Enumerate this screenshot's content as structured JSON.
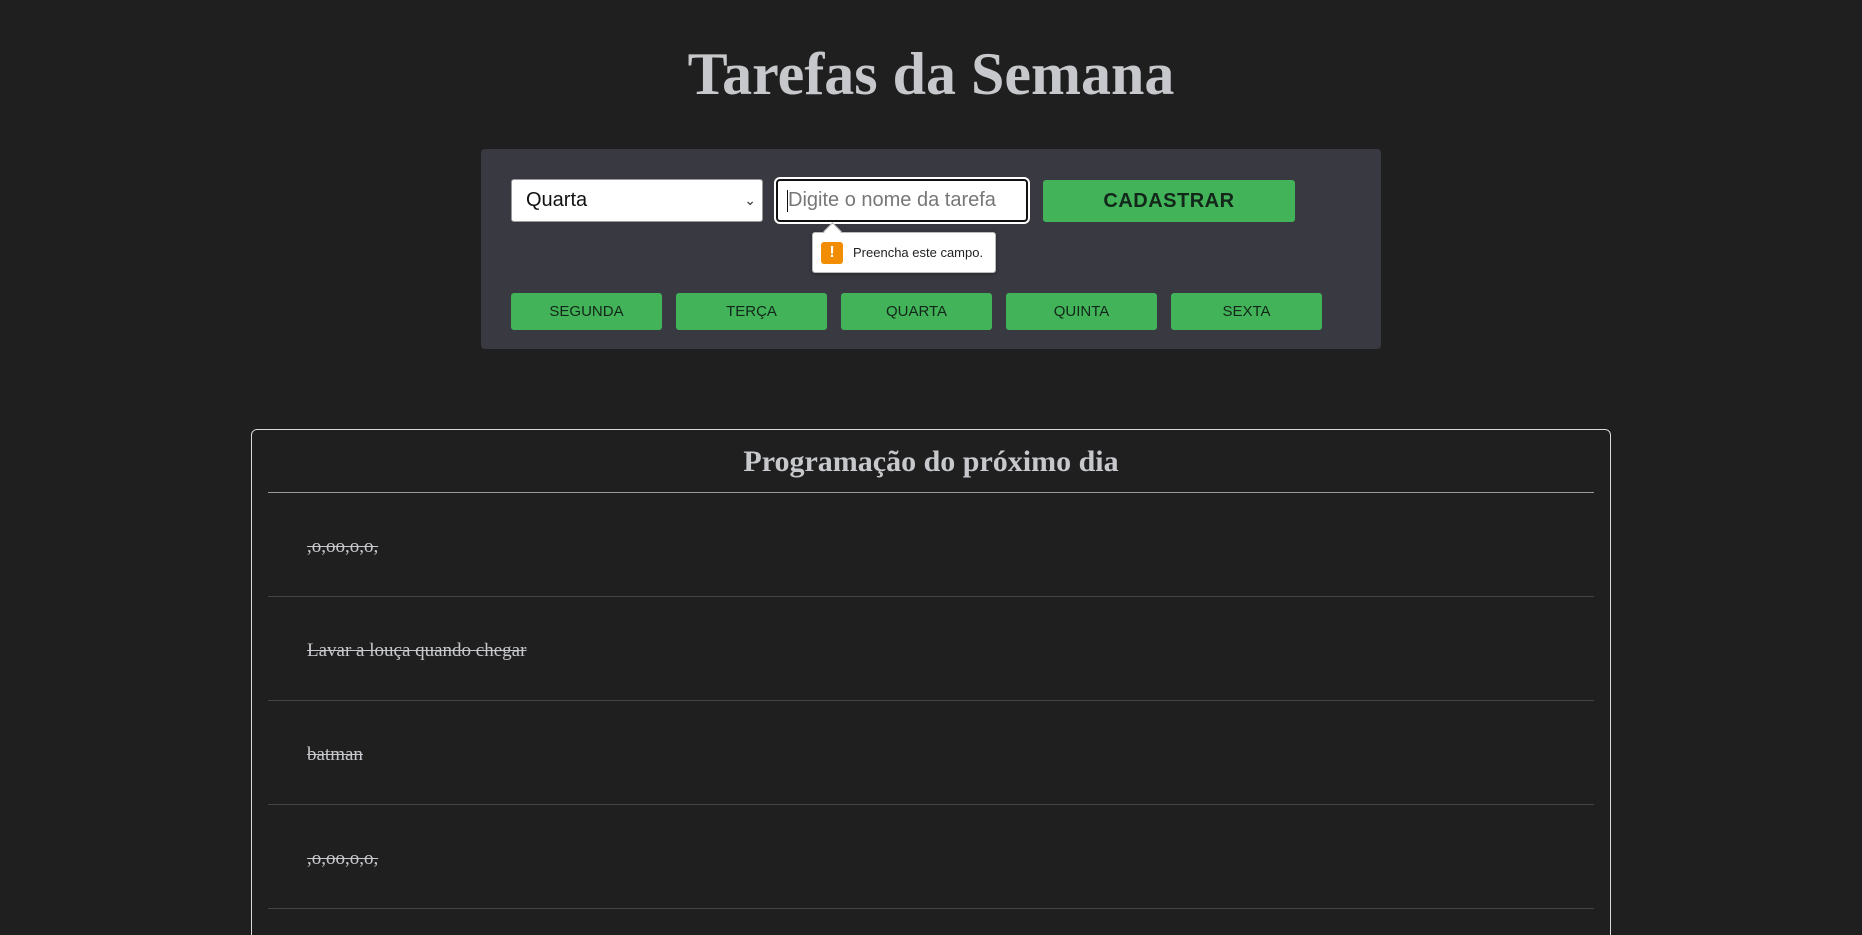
{
  "header": {
    "title": "Tarefas da Semana"
  },
  "form": {
    "day_select": {
      "selected": "Quarta"
    },
    "task_input": {
      "value": "",
      "placeholder": "Digite o nome da tarefa"
    },
    "register_label": "CADASTRAR",
    "validation_tooltip": "Preencha este campo."
  },
  "day_buttons": [
    {
      "label": "SEGUNDA"
    },
    {
      "label": "TERÇA"
    },
    {
      "label": "QUARTA"
    },
    {
      "label": "QUINTA"
    },
    {
      "label": "SEXTA"
    }
  ],
  "schedule": {
    "title": "Programação do próximo dia",
    "tasks": [
      {
        "text": ",o,oo,o,o,",
        "done": true
      },
      {
        "text": "Lavar a louça quando chegar",
        "done": true
      },
      {
        "text": "batman",
        "done": true
      },
      {
        "text": ",o,oo,o,o,",
        "done": true
      }
    ]
  },
  "colors": {
    "background": "#201f20",
    "panel": "#393942",
    "accent_green": "#42b359",
    "title_text": "#c6c8cc",
    "warning_orange": "#f28c00"
  },
  "icons": {
    "select_arrow": "chevron-down-icon",
    "tooltip_warning": "warning-icon"
  }
}
